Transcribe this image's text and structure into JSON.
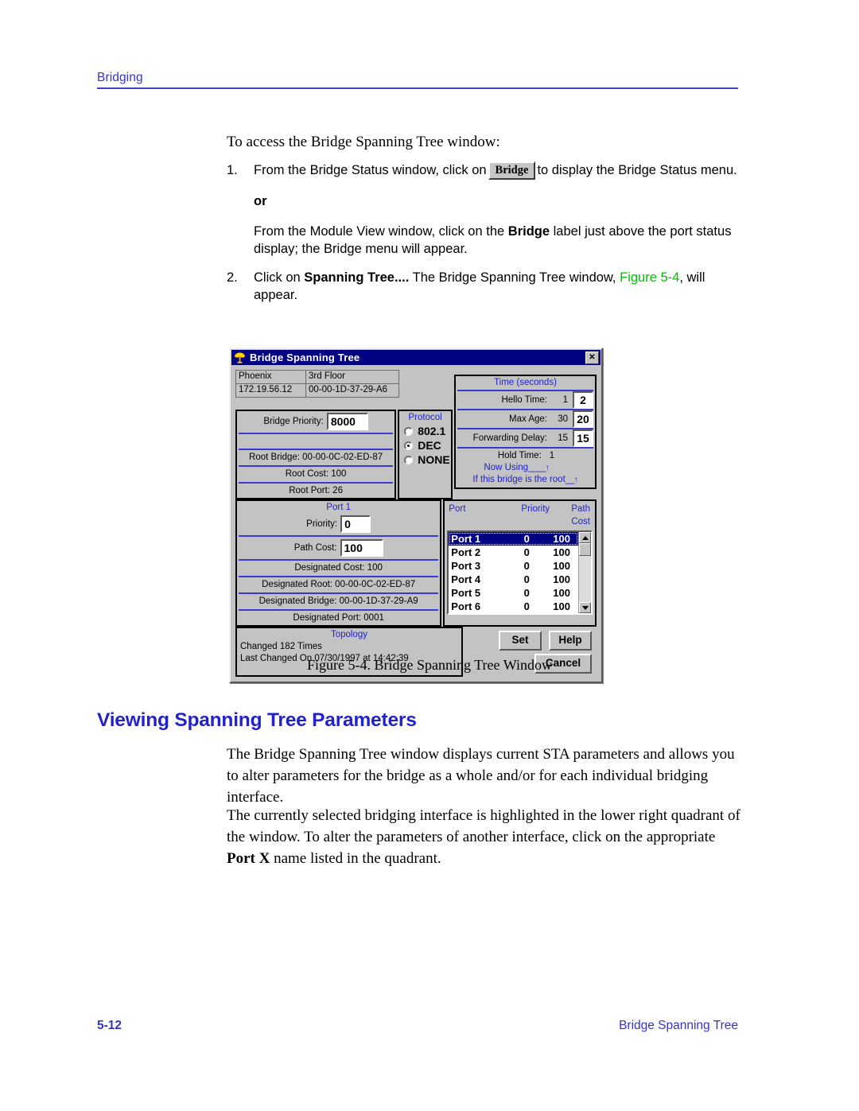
{
  "page": {
    "header_label": "Bridging",
    "footer_page": "5-12",
    "footer_section": "Bridge Spanning Tree"
  },
  "content": {
    "intro": "To access the Bridge Spanning Tree window:",
    "step1": {
      "num": "1.",
      "text_before": "From the Bridge Status window, click on",
      "inline_button": "Bridge",
      "text_after": "to display the Bridge Status menu.",
      "or": "or",
      "alt_before": "From the Module View window, click on the",
      "alt_bold": "Bridge",
      "alt_after": "label just above the port status display; the Bridge menu will appear."
    },
    "step2": {
      "num": "2.",
      "text_before": "Click on",
      "bold": "Spanning Tree....",
      "text_mid": "The Bridge Spanning Tree window,",
      "figref": "Figure 5-4",
      "text_after": ", will appear."
    },
    "figure_caption": "Figure 5-4.  Bridge Spanning Tree Window",
    "section_heading": "Viewing Spanning Tree Parameters",
    "para1": "The Bridge Spanning Tree window displays current STA parameters and allows you to alter parameters for the bridge as a whole and/or for each individual bridging interface.",
    "para2_before": "The currently selected bridging interface is highlighted in the lower right quadrant of the window. To alter the parameters of another interface, click on the appropriate",
    "para2_bold": "Port X",
    "para2_after": "name listed in the quadrant."
  },
  "dialog": {
    "title": "Bridge Spanning Tree",
    "title_icon": "tree-icon",
    "close_label": "✕",
    "identity": {
      "device_name": "Phoenix",
      "location": "3rd Floor",
      "ip_address": "172.19.56.12",
      "mac_address": "00-00-1D-37-29-A6"
    },
    "bridge_panel": {
      "priority_label": "Bridge Priority:",
      "priority_value": "8000",
      "root_bridge": "Root Bridge: 00-00-0C-02-ED-87",
      "root_cost": "Root Cost: 100",
      "root_port": "Root Port: 26"
    },
    "protocol_panel": {
      "title": "Protocol",
      "options": [
        {
          "label": "802.1",
          "selected": false
        },
        {
          "label": "DEC",
          "selected": true
        },
        {
          "label": "NONE",
          "selected": false
        }
      ]
    },
    "time_panel": {
      "title": "Time (seconds)",
      "rows": [
        {
          "label": "Hello Time:",
          "current": "1",
          "editable": "2"
        },
        {
          "label": "Max Age:",
          "current": "30",
          "editable": "20"
        },
        {
          "label": "Forwarding Delay:",
          "current": "15",
          "editable": "15"
        }
      ],
      "hold_time_label": "Hold Time:",
      "hold_time_value": "1",
      "note_now_using": "Now Using",
      "note_if_root": "If this bridge is the root"
    },
    "port_panel": {
      "title": "Port 1",
      "priority_label": "Priority:",
      "priority_value": "0",
      "path_cost_label": "Path Cost:",
      "path_cost_value": "100",
      "designated_cost": "Designated Cost: 100",
      "designated_root": "Designated Root: 00-00-0C-02-ED-87",
      "designated_bridge": "Designated Bridge: 00-00-1D-37-29-A9",
      "designated_port": "Designated Port: 0001"
    },
    "port_list": {
      "columns": [
        "Port",
        "Priority",
        "Path Cost"
      ],
      "rows": [
        {
          "port": "Port 1",
          "priority": "0",
          "path_cost": "100",
          "selected": true
        },
        {
          "port": "Port 2",
          "priority": "0",
          "path_cost": "100",
          "selected": false
        },
        {
          "port": "Port 3",
          "priority": "0",
          "path_cost": "100",
          "selected": false
        },
        {
          "port": "Port 4",
          "priority": "0",
          "path_cost": "100",
          "selected": false
        },
        {
          "port": "Port 5",
          "priority": "0",
          "path_cost": "100",
          "selected": false
        },
        {
          "port": "Port 6",
          "priority": "0",
          "path_cost": "100",
          "selected": false
        }
      ]
    },
    "topology": {
      "title": "Topology",
      "changed": "Changed 182 Times",
      "last_changed": "Last Changed On 07/30/1997 at 14:42:39"
    },
    "buttons": {
      "set": "Set",
      "help": "Help",
      "cancel": "Cancel"
    }
  },
  "colors": {
    "accent_blue": "#2222cc",
    "link_green": "#00c000",
    "titlebar": "#000080",
    "dialog_face": "#c3c3c3"
  }
}
